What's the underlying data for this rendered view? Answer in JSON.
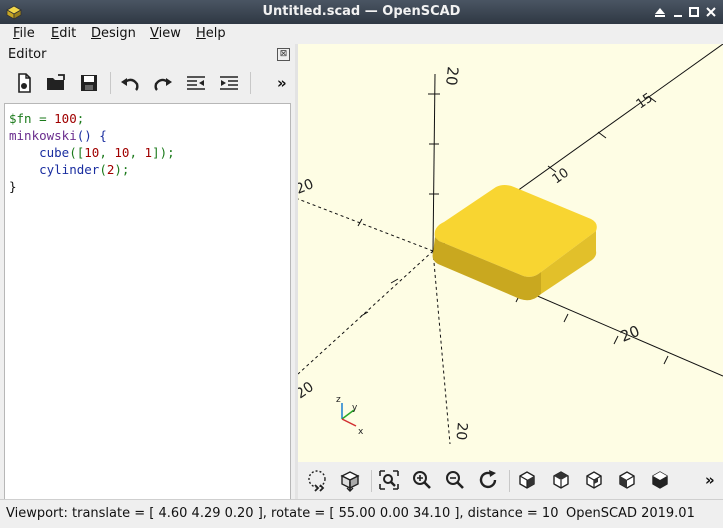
{
  "window": {
    "title": "Untitled.scad — OpenSCAD"
  },
  "menubar": [
    {
      "first": "F",
      "rest": "ile"
    },
    {
      "first": "E",
      "rest": "dit"
    },
    {
      "first": "D",
      "rest": "esign"
    },
    {
      "first": "V",
      "rest": "iew"
    },
    {
      "first": "H",
      "rest": "elp"
    }
  ],
  "editor": {
    "title": "Editor",
    "close_glyph": "⊠",
    "toolbar_more": "»",
    "toolbar_icons": [
      "new-file-icon",
      "open-file-icon",
      "save-icon",
      "undo-icon",
      "redo-icon",
      "unindent-icon",
      "indent-icon"
    ],
    "code": {
      "l1_var": "$fn",
      "l1_eq": " = ",
      "l1_num": "100",
      "l1_end": ";",
      "l2_kw": "minkowski",
      "l2_rest": "() {",
      "l3_fn": "cube",
      "l3_open": "([",
      "l3_n1": "10",
      "l3_c1": ", ",
      "l3_n2": "10",
      "l3_c2": ", ",
      "l3_n3": "1",
      "l3_close": "]);",
      "l4_fn": "cylinder",
      "l4_open": "(",
      "l4_n1": "2",
      "l4_close": ");",
      "l5": "}"
    }
  },
  "viewport": {
    "axis_labels": [
      "20",
      "15",
      "10",
      "20",
      "20",
      "20",
      "20"
    ],
    "gizmo": {
      "x": "x",
      "y": "y",
      "z": "z"
    },
    "colors": {
      "background": "#fefde4",
      "model_top": "#f8d531",
      "model_side": "#c9a81f"
    }
  },
  "view_toolbar": {
    "icons": [
      "preview-icon",
      "render-icon",
      "view-all-icon",
      "zoom-in-icon",
      "zoom-out-icon",
      "reset-view-icon",
      "view-right-icon",
      "view-top-icon",
      "view-bottom-icon",
      "view-left-icon",
      "view-front-icon"
    ],
    "more": "»"
  },
  "statusbar": {
    "viewport_info": "Viewport: translate = [ 4.60 4.29 0.20 ], rotate = [ 55.00 0.00 34.10 ], distance = 10",
    "version": "OpenSCAD 2019.01"
  }
}
